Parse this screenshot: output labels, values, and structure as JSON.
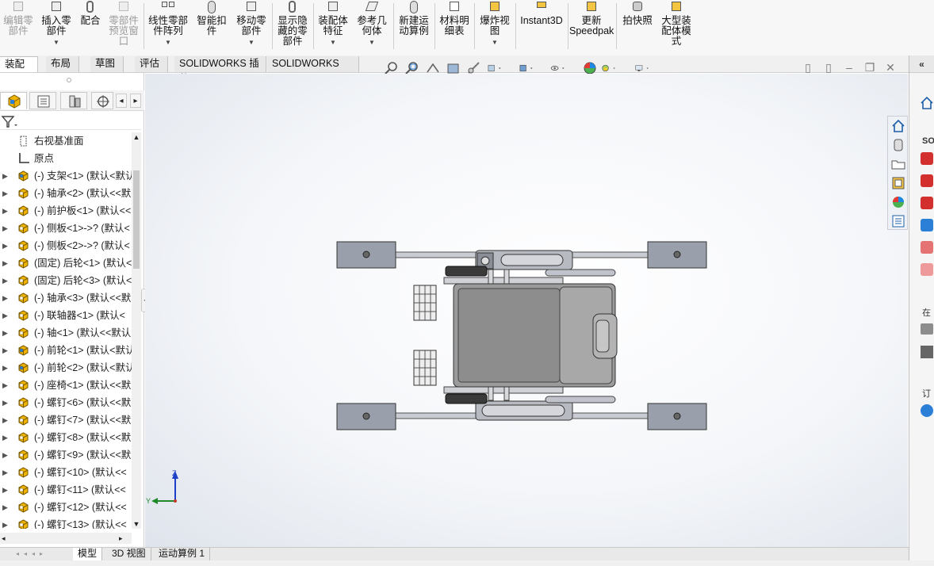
{
  "ribbon": {
    "buttons": [
      {
        "id": "edit-component",
        "label": "编辑零部件",
        "disabled": true
      },
      {
        "id": "insert-component",
        "label": "插入零部件",
        "disabled": false,
        "dropdown": true
      },
      {
        "id": "mate",
        "label": "配合",
        "disabled": false
      },
      {
        "id": "component-preview",
        "label": "零部件预览窗口",
        "disabled": true
      },
      {
        "id": "linear-pattern",
        "label": "线性零部件阵列",
        "disabled": false,
        "dropdown": true
      },
      {
        "id": "smart-fasteners",
        "label": "智能扣件",
        "disabled": false
      },
      {
        "id": "move-component",
        "label": "移动零部件",
        "disabled": false,
        "dropdown": true
      },
      {
        "id": "show-hidden",
        "label": "显示隐藏的零部件",
        "disabled": false
      },
      {
        "id": "assembly-features",
        "label": "装配体特征",
        "disabled": false,
        "dropdown": true
      },
      {
        "id": "reference-geometry",
        "label": "参考几何体",
        "disabled": false,
        "dropdown": true
      },
      {
        "id": "new-motion-study",
        "label": "新建运动算例",
        "disabled": false
      },
      {
        "id": "bill-of-materials",
        "label": "材料明细表",
        "disabled": false
      },
      {
        "id": "exploded-view",
        "label": "爆炸视图",
        "disabled": false,
        "dropdown": true
      },
      {
        "id": "instant3d",
        "label": "Instant3D",
        "disabled": false
      },
      {
        "id": "update-speedpak",
        "label": "更新Speedpak",
        "disabled": false
      },
      {
        "id": "take-snapshot",
        "label": "拍快照",
        "disabled": false
      },
      {
        "id": "large-assembly-mode",
        "label": "大型装配体模式",
        "disabled": false
      }
    ]
  },
  "command_tabs": [
    "装配体",
    "布局",
    "草图",
    "评估",
    "SOLIDWORKS 插件",
    "SOLIDWORKS MBD"
  ],
  "active_command_tab": "装配体",
  "tree": {
    "items": [
      {
        "label": "右视基准面",
        "icon": "plane-icon",
        "expandable": false
      },
      {
        "label": "原点",
        "icon": "origin-icon",
        "expandable": false
      },
      {
        "label": "(-) 支架<1> (默认<默认",
        "icon": "part-icon",
        "expandable": true
      },
      {
        "label": "(-) 轴承<2> (默认<<默",
        "icon": "part-icon",
        "expandable": true
      },
      {
        "label": "(-) 前护板<1> (默认<<",
        "icon": "part-icon",
        "expandable": true
      },
      {
        "label": "(-) 侧板<1>->? (默认<",
        "icon": "part-icon",
        "expandable": true
      },
      {
        "label": "(-) 侧板<2>->? (默认<",
        "icon": "part-icon",
        "expandable": true
      },
      {
        "label": "(固定) 后轮<1> (默认<",
        "icon": "part-icon",
        "expandable": true
      },
      {
        "label": "(固定) 后轮<3> (默认<",
        "icon": "part-icon",
        "expandable": true
      },
      {
        "label": "(-) 轴承<3> (默认<<默",
        "icon": "part-icon",
        "expandable": true
      },
      {
        "label": "(-) 联轴器<1> (默认<",
        "icon": "part-icon",
        "expandable": true
      },
      {
        "label": "(-) 轴<1> (默认<<默认",
        "icon": "part-icon",
        "expandable": true
      },
      {
        "label": "(-) 前轮<1> (默认<默认",
        "icon": "part-icon",
        "expandable": true
      },
      {
        "label": "(-) 前轮<2> (默认<默认",
        "icon": "part-icon",
        "expandable": true
      },
      {
        "label": "(-) 座椅<1> (默认<<默",
        "icon": "part-icon",
        "expandable": true
      },
      {
        "label": "(-) 螺钉<6> (默认<<默",
        "icon": "part-icon",
        "expandable": true
      },
      {
        "label": "(-) 螺钉<7> (默认<<默",
        "icon": "part-icon",
        "expandable": true
      },
      {
        "label": "(-) 螺钉<8> (默认<<默",
        "icon": "part-icon",
        "expandable": true
      },
      {
        "label": "(-) 螺钉<9> (默认<<默",
        "icon": "part-icon",
        "expandable": true
      },
      {
        "label": "(-) 螺钉<10> (默认<<",
        "icon": "part-icon",
        "expandable": true
      },
      {
        "label": "(-) 螺钉<11> (默认<<",
        "icon": "part-icon",
        "expandable": true
      },
      {
        "label": "(-) 螺钉<12> (默认<<",
        "icon": "part-icon",
        "expandable": true
      },
      {
        "label": "(-) 螺钉<13> (默认<<",
        "icon": "part-icon",
        "expandable": true
      }
    ]
  },
  "bottom_tabs": [
    "模型",
    "3D 视图",
    "运动算例 1"
  ],
  "active_bottom_tab": "模型",
  "triad": {
    "z": "Z",
    "y": "Y"
  },
  "taskpane": {
    "labels": [
      "SO",
      "在",
      "订"
    ]
  },
  "colors": {
    "ribbon_bg": "#f7f7f7",
    "part_icon": "#f0b400",
    "part_icon_blue": "#2b7fd6",
    "model_gray": "#8d8d8d"
  }
}
